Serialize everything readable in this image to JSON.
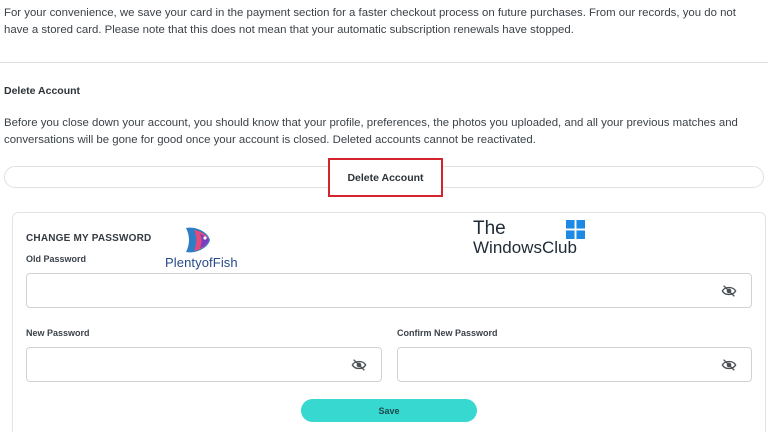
{
  "payment": {
    "notice": "For your convenience, we save your card in the payment section for a faster checkout process on future purchases. From our records, you do not have a stored card. Please note that this does not mean that your automatic subscription renewals have stopped."
  },
  "delete_account": {
    "title": "Delete Account",
    "warning": "Before you close down your account, you should know that your profile, preferences, the photos you uploaded, and all your previous matches and conversations will be gone for good once your account is closed. Deleted accounts cannot be reactivated.",
    "button_label": "Delete Account",
    "highlight_color": "#d4242e"
  },
  "change_password": {
    "title": "CHANGE MY PASSWORD",
    "old_password_label": "Old Password",
    "new_password_label": "New Password",
    "confirm_password_label": "Confirm New Password",
    "save_label": "Save",
    "accent_color": "#36d8d0",
    "toggle_icon": "eye-off-icon"
  },
  "watermarks": {
    "plentyoffish": "PlentyofFish",
    "twc_line1": "The",
    "twc_line2": "WindowsClub"
  }
}
